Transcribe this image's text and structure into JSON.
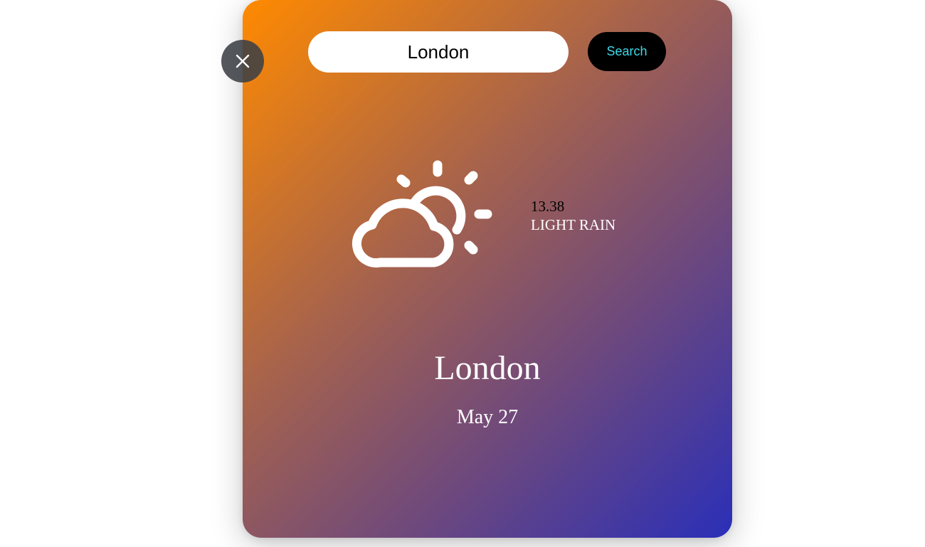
{
  "search": {
    "value": "London",
    "button_label": "Search"
  },
  "close_button": {
    "icon": "close-icon"
  },
  "weather": {
    "icon": "partly-cloudy-icon",
    "temperature": "13.38",
    "description": "LIGHT RAIN",
    "city": "London",
    "date": "May 27"
  },
  "colors": {
    "gradient_start": "#ff8a00",
    "gradient_end": "#2a2fb8",
    "search_button_bg": "#000000",
    "search_button_text": "#3fd8e6"
  }
}
